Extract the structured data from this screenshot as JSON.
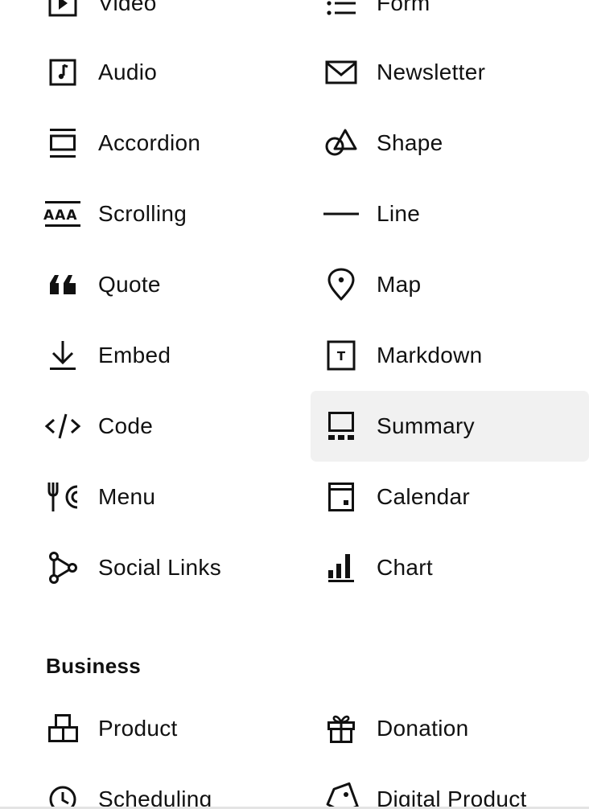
{
  "blocks": {
    "video": "Video",
    "form": "Form",
    "audio": "Audio",
    "newsletter": "Newsletter",
    "accordion": "Accordion",
    "shape": "Shape",
    "scrolling": "Scrolling",
    "line": "Line",
    "quote": "Quote",
    "map": "Map",
    "embed": "Embed",
    "markdown": "Markdown",
    "code": "Code",
    "summary": "Summary",
    "menu": "Menu",
    "calendar": "Calendar",
    "social_links": "Social Links",
    "chart": "Chart"
  },
  "business": {
    "heading": "Business",
    "product": "Product",
    "donation": "Donation",
    "scheduling": "Scheduling",
    "digital_product": "Digital Product"
  },
  "scrolling_icon_text": "AAA",
  "markdown_icon_text": "T",
  "colors": {
    "text": "#111111",
    "hover_background": "#f1f1f1",
    "divider": "#e4e4e4"
  }
}
